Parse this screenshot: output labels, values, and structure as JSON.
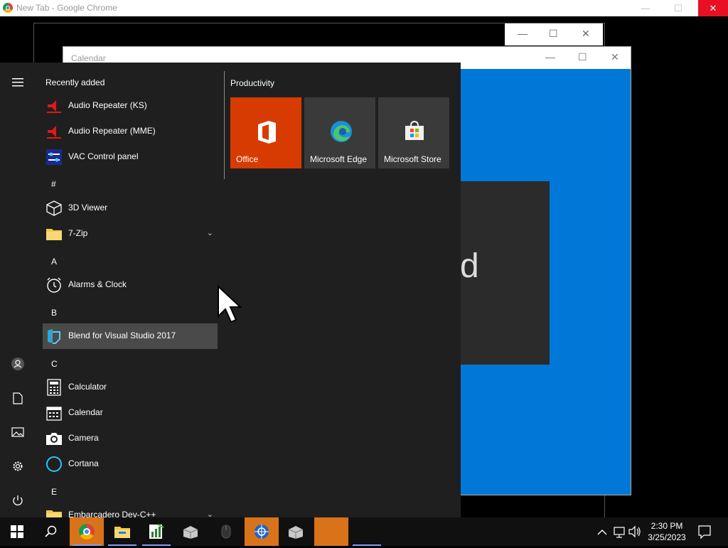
{
  "chrome": {
    "title": "New Tab - Google Chrome",
    "minimize": "—",
    "maximize": "☐",
    "close": "✕"
  },
  "calendar_window": {
    "title": "Calendar",
    "preview_text": "d",
    "colors": {
      "accent": "#0078d7"
    }
  },
  "start_menu": {
    "recently_added_title": "Recently added",
    "recent": [
      {
        "label": "Audio Repeater (KS)",
        "icon": "audio-repeater-icon"
      },
      {
        "label": "Audio Repeater (MME)",
        "icon": "audio-repeater-icon"
      },
      {
        "label": "VAC Control panel",
        "icon": "vac-control-panel-icon"
      }
    ],
    "groups": {
      "hash": "#",
      "a": "A",
      "b": "B",
      "c": "C",
      "e": "E"
    },
    "apps": {
      "viewer3d": "3D Viewer",
      "zip7": "7-Zip",
      "alarms": "Alarms & Clock",
      "blend": "Blend for Visual Studio 2017",
      "calculator": "Calculator",
      "calendar": "Calendar",
      "camera": "Camera",
      "cortana": "Cortana",
      "embarcadero": "Embarcadero Dev-C++"
    },
    "productivity": {
      "title": "Productivity",
      "tiles": [
        {
          "label": "Office",
          "icon": "office-icon",
          "color": "#d83b01"
        },
        {
          "label": "Microsoft Edge",
          "icon": "edge-icon",
          "color": "#3a3a3a"
        },
        {
          "label": "Microsoft Store",
          "icon": "store-icon",
          "color": "#3a3a3a"
        }
      ]
    }
  },
  "taskbar": {
    "time": "2:30 PM",
    "date": "3/25/2023"
  }
}
